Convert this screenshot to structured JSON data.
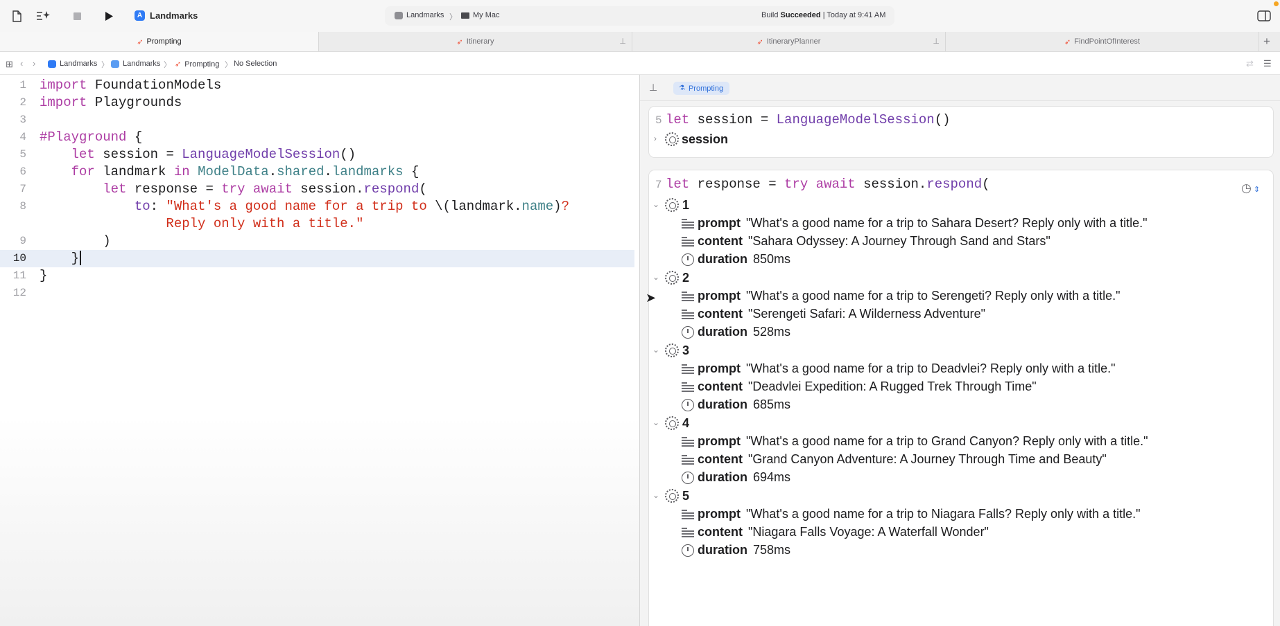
{
  "toolbar": {
    "scheme_name": "Landmarks",
    "destination_project": "Landmarks",
    "destination_device": "My Mac",
    "build_status_prefix": "Build",
    "build_status": "Succeeded",
    "build_time": "| Today at 9:41 AM"
  },
  "tabs": [
    {
      "label": "Prompting"
    },
    {
      "label": "Itinerary"
    },
    {
      "label": "ItineraryPlanner"
    },
    {
      "label": "FindPointOfInterest"
    }
  ],
  "breadcrumb": [
    "Landmarks",
    "Landmarks",
    "Prompting",
    "No Selection"
  ],
  "editor": {
    "line_numbers": [
      "1",
      "2",
      "3",
      "4",
      "5",
      "6",
      "7",
      "8",
      "",
      "9",
      "10",
      "11",
      "12"
    ]
  },
  "canvas": {
    "chip_label": "Prompting",
    "session_card": {
      "line_number": "5",
      "session_label": "session"
    },
    "response_card": {
      "line_number": "7",
      "items": [
        {
          "index": "1",
          "prompt": "\"What's a good name for a trip to Sahara Desert?  Reply only with a title.\"",
          "content": "\"Sahara Odyssey: A Journey Through Sand and Stars\"",
          "duration": "850ms"
        },
        {
          "index": "2",
          "prompt": "\"What's a good name for a trip to Serengeti?  Reply only with a title.\"",
          "content": "\"Serengeti Safari: A Wilderness Adventure\"",
          "duration": "528ms"
        },
        {
          "index": "3",
          "prompt": "\"What's a good name for a trip to Deadvlei?  Reply only with a title.\"",
          "content": "\"Deadvlei Expedition: A Rugged Trek Through Time\"",
          "duration": "685ms"
        },
        {
          "index": "4",
          "prompt": "\"What's a good name for a trip to Grand Canyon?  Reply only with a title.\"",
          "content": "\"Grand Canyon Adventure: A Journey Through Time and Beauty\"",
          "duration": "694ms"
        },
        {
          "index": "5",
          "prompt": "\"What's a good name for a trip to Niagara Falls?  Reply only with a title.\"",
          "content": "\"Niagara Falls Voyage: A Waterfall Wonder\"",
          "duration": "758ms"
        }
      ],
      "labels": {
        "prompt": "prompt",
        "content": "content",
        "duration": "duration"
      }
    }
  },
  "colors": {
    "keyword": "#ad3da4",
    "type": "#703daa",
    "property": "#3e8087",
    "string": "#d12f1b",
    "accent": "#2f6fd9"
  },
  "icons": [
    "new-file-icon",
    "magic-wand-icon",
    "stop-icon",
    "run-icon",
    "inspector-toggle-icon",
    "pin-icon",
    "gear-icon",
    "lines-icon",
    "timer-icon",
    "history-icon",
    "chevron-down-icon",
    "chevron-right-icon"
  ]
}
